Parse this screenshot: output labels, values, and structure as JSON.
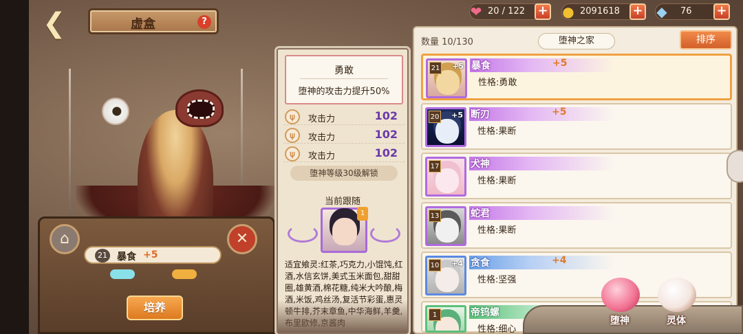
{
  "header": {
    "title": "虚盒",
    "help": "?"
  },
  "resources": {
    "stamina": "20 / 122",
    "gold": "2091618",
    "crystal": "76"
  },
  "character": {
    "level": "21",
    "name": "暴食",
    "plus": "+5",
    "train_label": "培养"
  },
  "trait": {
    "name": "勇敢",
    "description": "堕神的攻击力提升50%"
  },
  "stats": [
    {
      "label": "攻击力",
      "value": "102"
    },
    {
      "label": "攻击力",
      "value": "102"
    },
    {
      "label": "攻击力",
      "value": "102"
    }
  ],
  "unlock_text": "堕神等级30级解锁",
  "follow": {
    "label": "当前跟随"
  },
  "recipe_text": "适宜飨灵:红茶,巧克力,小馄饨,红酒,水信玄饼,美式玉米面包,甜甜圈,雄黄酒,棉花糖,纯米大吟酿,梅酒,米饭,鸡丝汤,复活节彩蛋,惠灵顿牛排,芥末章鱼,中华海鲜,羊羹,布里欧修,京酱肉",
  "list": {
    "count": "数量 10/130",
    "home": "堕神之家",
    "sort": "排序",
    "items": [
      {
        "level": "21",
        "badge": "+5",
        "name": "暴食",
        "plus": "+5",
        "trait": "性格:勇敢"
      },
      {
        "level": "20",
        "badge": "+5",
        "name": "断刃",
        "plus": "+5",
        "trait": "性格:果断"
      },
      {
        "level": "17",
        "badge": "",
        "name": "犬神",
        "plus": "",
        "trait": "性格:果断"
      },
      {
        "level": "13",
        "badge": "",
        "name": "蛇君",
        "plus": "",
        "trait": "性格:果断"
      },
      {
        "level": "10",
        "badge": "+4",
        "name": "贪食",
        "plus": "+4",
        "trait": "性格:坚强"
      },
      {
        "level": "1",
        "badge": "",
        "name": "帝钨螺",
        "plus": "",
        "trait": "性格:细心"
      }
    ]
  },
  "tabs": {
    "fallen_god": "堕神",
    "spirit": "灵体"
  },
  "colors": {
    "accent_orange": "#e07a2a",
    "stat_purple": "#6a3aa8",
    "rarity_purple": "#b06ae0"
  }
}
